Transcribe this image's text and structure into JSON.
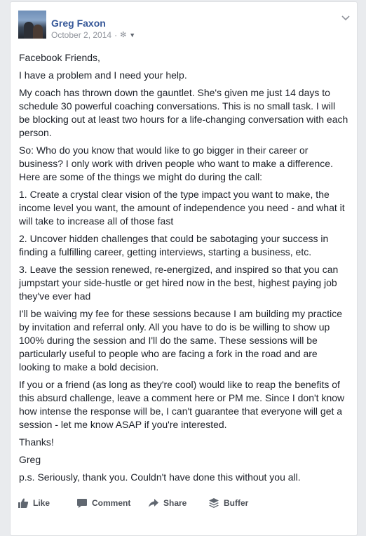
{
  "post": {
    "author": "Greg Faxon",
    "date": "October 2, 2014",
    "meta_separator": "·",
    "privacy_icon": "gear-globe-icon",
    "menu_icon": "chevron-down-icon",
    "paragraphs": [
      "Facebook Friends,",
      "I have a problem and I need your help.",
      "My coach has thrown down the gauntlet. She's given me just 14 days to schedule 30 powerful coaching conversations. This is no small task. I will be blocking out at least two hours for a life-changing conversation with each person.",
      "So: Who do you know that would like to go bigger in their career or business? I only work with driven people who want to make a difference. Here are some of the things we might do during the call:",
      "1. Create a crystal clear vision of the type impact you want to make, the income level you want, the amount of independence you need - and what it will take to increase all of those fast",
      "2. Uncover hidden challenges that could be sabotaging your success in finding a fulfilling career, getting interviews, starting a business, etc.",
      "3. Leave the session renewed, re-energized, and inspired so that you can jumpstart your side-hustle or get hired now in the best, highest paying job they've ever had",
      "I'll be waiving my fee for these sessions because I am building my practice by invitation and referral only. All you have to do is be willing to show up 100% during the session and I'll do the same. These sessions will be particularly useful to people who are facing a fork in the road and are looking to make a bold decision.",
      "If you or a friend (as long as they're cool) would like to reap the benefits of this absurd challenge, leave a comment here or PM me. Since I don't know how intense the response will be, I can't guarantee that everyone will get a session - let me know ASAP if you're interested.",
      "Thanks!",
      "Greg",
      "p.s. Seriously, thank you. Couldn't have done this without you all."
    ]
  },
  "actions": {
    "like": "Like",
    "comment": "Comment",
    "share": "Share",
    "buffer": "Buffer"
  },
  "colors": {
    "author_link": "#365899",
    "meta_gray": "#90949c",
    "action_gray": "#4b4f56"
  }
}
